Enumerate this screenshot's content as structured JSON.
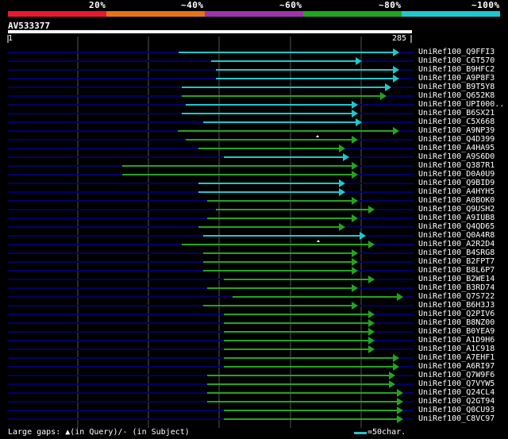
{
  "legend": {
    "colors": [
      "#e8192c",
      "#e67417",
      "#9b36a8",
      "#22a522",
      "#1ec8cc"
    ],
    "labels": [
      "20%",
      "~40%",
      "~60%",
      "~80%",
      "~100%"
    ]
  },
  "query": {
    "name": "AV533377",
    "start": "1",
    "end": "285"
  },
  "hits": [
    {
      "name": "UniRef100_Q9FFI3",
      "color": "cyan",
      "start": 225,
      "end": 503,
      "segs": 1
    },
    {
      "name": "UniRef100_C6T570",
      "color": "cyan",
      "start": 266,
      "end": 456,
      "segs": 1
    },
    {
      "name": "UniRef100_B9HFC2",
      "color": "cyan",
      "start": 272,
      "end": 503,
      "segs": 1
    },
    {
      "name": "UniRef100_A9P8F3",
      "color": "cyan",
      "start": 272,
      "end": 503,
      "segs": 1
    },
    {
      "name": "UniRef100_B9T5Y8",
      "color": "cyan",
      "start": 229,
      "end": 493,
      "segs": 1
    },
    {
      "name": "UniRef100_Q652K8",
      "color": "green",
      "start": 229,
      "end": 487,
      "segs": 1
    },
    {
      "name": "UniRef100_UPI000..",
      "color": "cyan",
      "start": 234,
      "end": 451,
      "segs": 1
    },
    {
      "name": "UniRef100_B6SX21",
      "color": "cyan",
      "start": 229,
      "end": 451,
      "segs": 1
    },
    {
      "name": "UniRef100_C5X668",
      "color": "cyan",
      "start": 256,
      "end": 456,
      "segs": 1
    },
    {
      "name": "UniRef100_A9NP39",
      "color": "green",
      "start": 224,
      "end": 503,
      "segs": 1
    },
    {
      "name": "UniRef100_Q4D399",
      "color": "green",
      "start": 234,
      "end": 451,
      "segs": 1,
      "gap": 400
    },
    {
      "name": "UniRef100_A4HA95",
      "color": "green",
      "start": 250,
      "end": 435,
      "segs": 1
    },
    {
      "name": "UniRef100_A9S6D0",
      "color": "cyan",
      "start": 282,
      "end": 440,
      "segs": 1
    },
    {
      "name": "UniRef100_Q387R1",
      "color": "green",
      "start": 154,
      "end": 451,
      "segs": 1
    },
    {
      "name": "UniRef100_D0A0U9",
      "color": "green",
      "start": 154,
      "end": 451,
      "segs": 1
    },
    {
      "name": "UniRef100_Q9BID9",
      "color": "cyan",
      "start": 250,
      "end": 435,
      "segs": 1
    },
    {
      "name": "UniRef100_A4HYH5",
      "color": "cyan",
      "start": 250,
      "end": 435,
      "segs": 1
    },
    {
      "name": "UniRef100_A0BOK0",
      "color": "green",
      "start": 261,
      "end": 451,
      "segs": 1
    },
    {
      "name": "UniRef100_Q9USH2",
      "color": "green",
      "start": 272,
      "end": 472,
      "segs": 1
    },
    {
      "name": "UniRef100_A9IUB8",
      "color": "green",
      "start": 261,
      "end": 451,
      "segs": 1
    },
    {
      "name": "UniRef100_Q4QD65",
      "color": "green",
      "start": 250,
      "end": 435,
      "segs": 1
    },
    {
      "name": "UniRef100_Q0A4R8",
      "color": "cyan",
      "start": 256,
      "end": 461,
      "segs": 1
    },
    {
      "name": "UniRef100_A2R2D4",
      "color": "green",
      "start": 229,
      "end": 472,
      "segs": 1,
      "gap": 401
    },
    {
      "name": "UniRef100_B4SRG8",
      "color": "green",
      "start": 256,
      "end": 451,
      "segs": 1
    },
    {
      "name": "UniRef100_B2FPT7",
      "color": "green",
      "start": 256,
      "end": 451,
      "segs": 1
    },
    {
      "name": "UniRef100_B8L6P7",
      "color": "green",
      "start": 256,
      "end": 451,
      "segs": 1
    },
    {
      "name": "UniRef100_B2WE14",
      "color": "green",
      "start": 282,
      "end": 472,
      "segs": 1
    },
    {
      "name": "UniRef100_B3RD74",
      "color": "green",
      "start": 261,
      "end": 451,
      "segs": 1
    },
    {
      "name": "UniRef100_Q7S722",
      "color": "green",
      "start": 293,
      "end": 508,
      "segs": 1
    },
    {
      "name": "UniRef100_B6H3J3",
      "color": "green",
      "start": 256,
      "end": 451,
      "segs": 1
    },
    {
      "name": "UniRef100_Q2PIV6",
      "color": "green",
      "start": 282,
      "end": 472,
      "segs": 1
    },
    {
      "name": "UniRef100_B8NZ00",
      "color": "green",
      "start": 282,
      "end": 472,
      "segs": 1
    },
    {
      "name": "UniRef100_B0YEA9",
      "color": "green",
      "start": 282,
      "end": 472,
      "segs": 1
    },
    {
      "name": "UniRef100_A1D9H6",
      "color": "green",
      "start": 282,
      "end": 472,
      "segs": 1
    },
    {
      "name": "UniRef100_A1C918",
      "color": "green",
      "start": 282,
      "end": 472,
      "segs": 1
    },
    {
      "name": "UniRef100_A7EHF1",
      "color": "green",
      "start": 282,
      "end": 503,
      "segs": 1
    },
    {
      "name": "UniRef100_A6RI97",
      "color": "green",
      "start": 282,
      "end": 503,
      "segs": 1
    },
    {
      "name": "UniRef100_Q7W9F6",
      "color": "green",
      "start": 261,
      "end": 498,
      "segs": 1
    },
    {
      "name": "UniRef100_Q7VYW5",
      "color": "green",
      "start": 261,
      "end": 498,
      "segs": 1
    },
    {
      "name": "UniRef100_Q24CL4",
      "color": "green",
      "start": 261,
      "end": 508,
      "segs": 1
    },
    {
      "name": "UniRef100_Q2GT94",
      "color": "green",
      "start": 261,
      "end": 508,
      "segs": 1
    },
    {
      "name": "UniRef100_Q0CU93",
      "color": "green",
      "start": 282,
      "end": 508,
      "segs": 1
    },
    {
      "name": "UniRef100_C8VC97",
      "color": "green",
      "start": 282,
      "end": 508,
      "segs": 1
    }
  ],
  "colors": {
    "cyan": "#1ec8cc",
    "green": "#22a522",
    "track": "#00006a",
    "grid": "#555555"
  },
  "footer": {
    "left": "Large gaps: ▲(in Query)/- (in Subject)",
    "right": "=50char."
  }
}
